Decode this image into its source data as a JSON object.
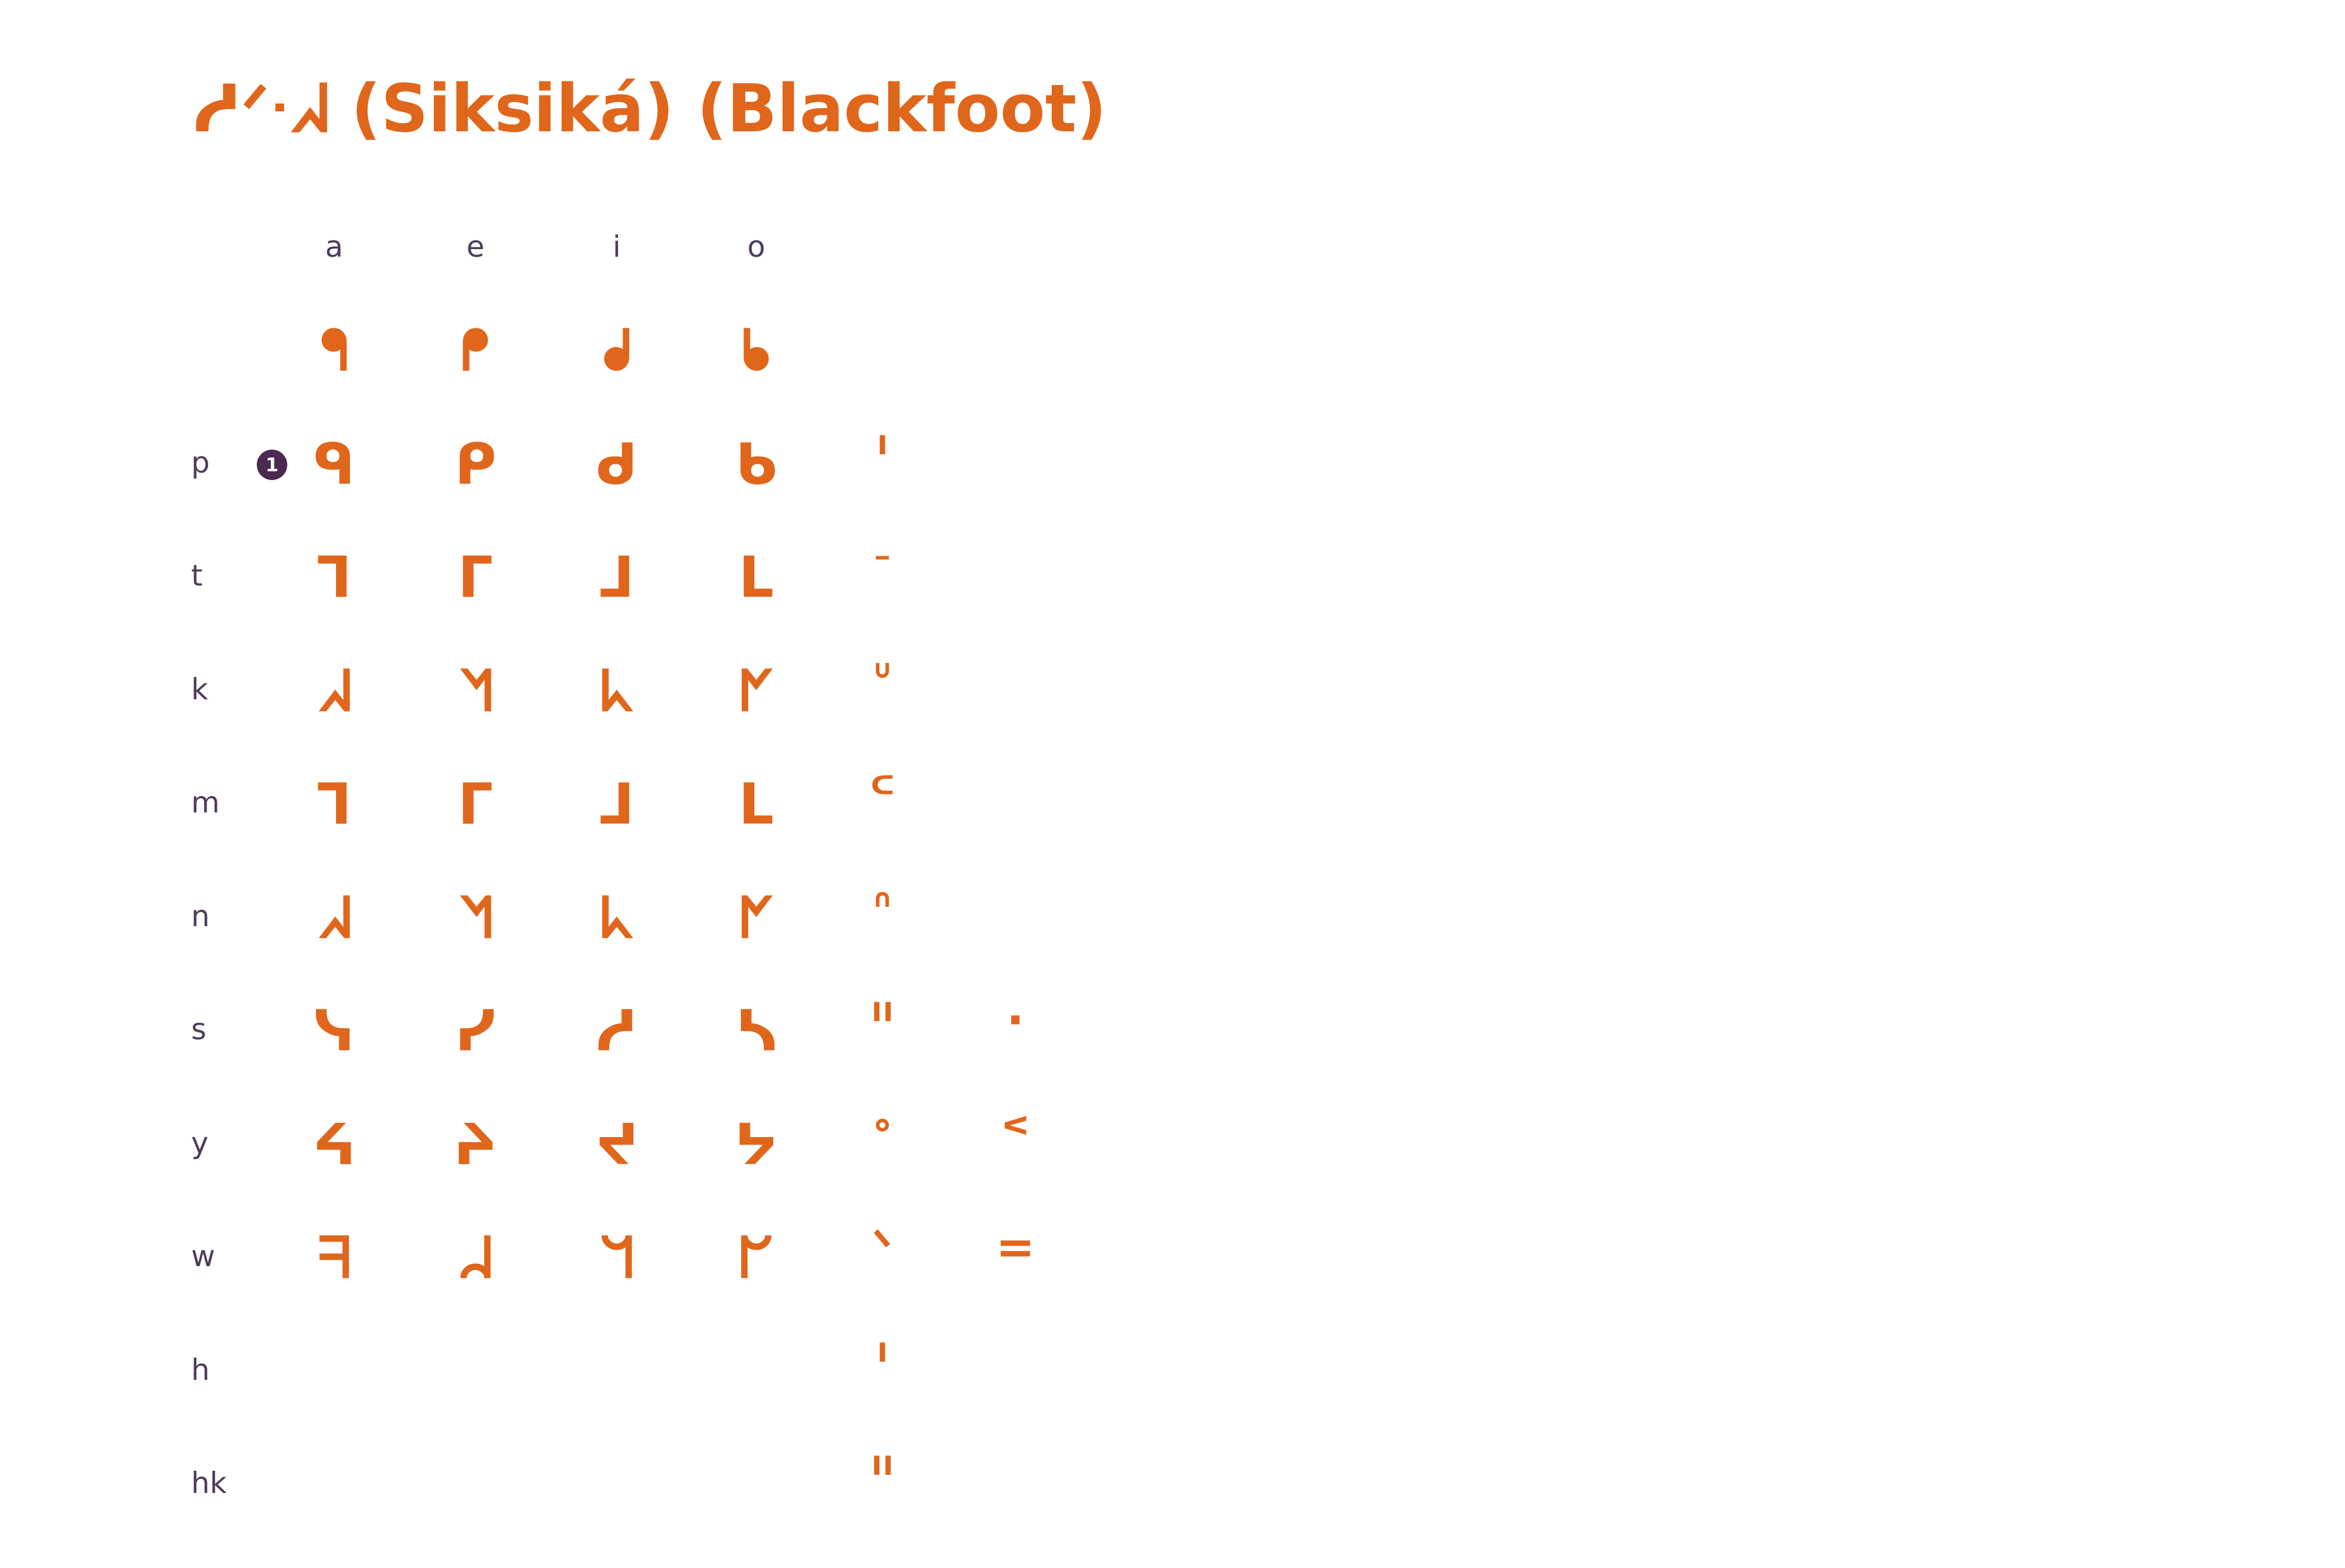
{
  "title": "ᓱᐟᐧᖽ (Siksiká) (Blackfoot)",
  "accent_color": "#e0661b",
  "label_color": "#4f3a5c",
  "badge_color": "#4b2a52",
  "vowels": [
    "a",
    "e",
    "i",
    "o"
  ],
  "note_badge": "1",
  "rows": [
    {
      "consonant": "",
      "syllables": [
        "ᖳ",
        "ᖰ",
        "ᖱ",
        "ᖲ"
      ],
      "final": "",
      "extra": ""
    },
    {
      "consonant": "p",
      "syllables": [
        "ᑫ",
        "ᑭ",
        "ᑯ",
        "ᑲ"
      ],
      "final": "ᑊ",
      "extra": ""
    },
    {
      "consonant": "t",
      "syllables": [
        "ᒣ",
        "ᒥ",
        "ᒧ",
        "ᒪ"
      ],
      "final": "ᐨ",
      "extra": ""
    },
    {
      "consonant": "k",
      "syllables": [
        "ᖽ",
        "ᖿ",
        "ᖾ",
        "ᖼ"
      ],
      "final": "ᐡ",
      "extra": ""
    },
    {
      "consonant": "m",
      "syllables": [
        "ᒣ",
        "ᒥ",
        "ᒧ",
        "ᒪ"
      ],
      "final": "ᒼ",
      "extra": ""
    },
    {
      "consonant": "n",
      "syllables": [
        "ᖽ",
        "ᖿ",
        "ᖾ",
        "ᖼ"
      ],
      "final": "ᐢ",
      "extra": ""
    },
    {
      "consonant": "s",
      "syllables": [
        "ᓭ",
        "ᓯ",
        "ᓱ",
        "ᓴ"
      ],
      "final": "ᐦ",
      "extra": "·"
    },
    {
      "consonant": "y",
      "syllables": [
        "ᔦ",
        "ᔨ",
        "ᔪ",
        "ᔭ"
      ],
      "final": "ᐤ",
      "extra": "ᑉ"
    },
    {
      "consonant": "w",
      "syllables": [
        "ᖷ",
        "ᖹ",
        "ᖻ",
        "ᖸ"
      ],
      "final": "ᐠ",
      "extra": "="
    },
    {
      "consonant": "h",
      "syllables": [
        "",
        "",
        "",
        ""
      ],
      "final": "ᑊ",
      "extra": ""
    },
    {
      "consonant": "hk",
      "syllables": [
        "",
        "",
        "",
        ""
      ],
      "final": "ᐦ",
      "extra": ""
    }
  ]
}
